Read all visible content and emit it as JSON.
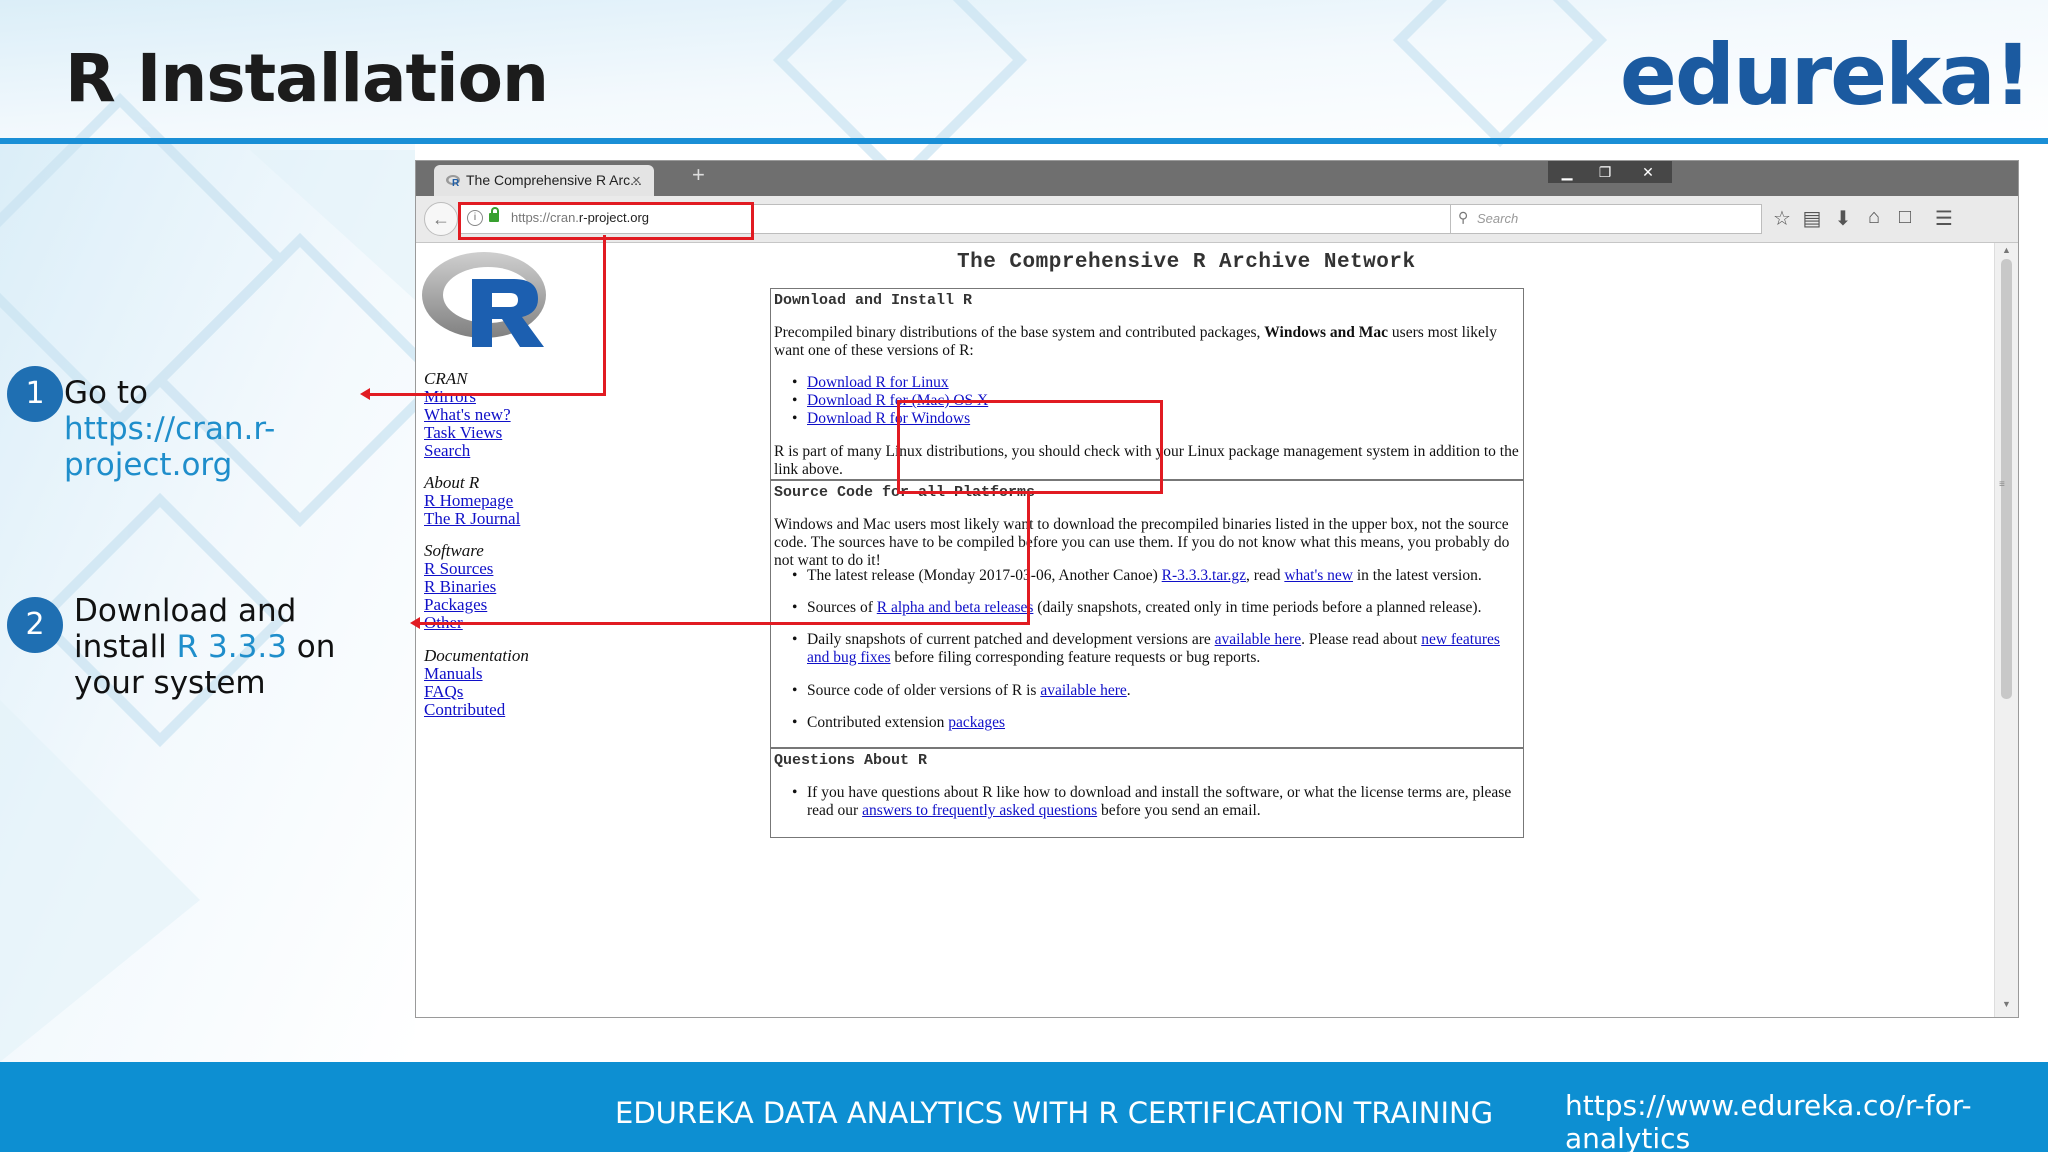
{
  "slide": {
    "title": "R Installation",
    "brand": "edureka!",
    "footer_course": "EDUREKA DATA ANALYTICS WITH R CERTIFICATION TRAINING",
    "footer_url": "https://www.edureka.co/r-for-analytics",
    "accent_color": "#1a8fd6",
    "brand_color": "#1b5aa0"
  },
  "steps": [
    {
      "number": "1",
      "text": "Go to ",
      "highlight": "https://cran.r-project.org"
    },
    {
      "number": "2",
      "text_before": "Download  and install ",
      "highlight": "R 3.3.3",
      "text_after": " on your system"
    }
  ],
  "browser": {
    "tab_label": "The Comprehensive R Arc...",
    "tab_close": "×",
    "new_tab": "+",
    "url_prefix": "https://cran.",
    "url_domain": "r-project.org",
    "search_placeholder": "Search",
    "window_controls": {
      "minimize": "▁",
      "restore": "❐",
      "close": "✕"
    },
    "toolbar_icons": [
      "star-icon",
      "reading-list-icon",
      "download-icon",
      "home-icon",
      "pocket-icon",
      "menu-icon"
    ]
  },
  "page": {
    "title": "The Comprehensive R Archive Network",
    "sidebar": [
      {
        "heading": "CRAN",
        "links": [
          "Mirrors",
          "What's new?",
          "Task Views",
          "Search"
        ]
      },
      {
        "heading": "About R",
        "links": [
          "R Homepage",
          "The R Journal"
        ]
      },
      {
        "heading": "Software",
        "links": [
          "R Sources",
          "R Binaries",
          "Packages",
          "Other"
        ]
      },
      {
        "heading": "Documentation",
        "links": [
          "Manuals",
          "FAQs",
          "Contributed"
        ]
      }
    ],
    "download_box": {
      "heading": "Download and Install R",
      "intro_1": "Precompiled binary distributions of the base system and contributed packages, ",
      "intro_bold": "Windows and Mac",
      "intro_2": " users most likely want one of these versions of R:",
      "links": [
        "Download R for Linux",
        "Download R for (Mac) OS X",
        "Download R for Windows"
      ],
      "note": "R is part of many Linux distributions, you should check with your Linux package management system in addition to the link above."
    },
    "source_box": {
      "heading": "Source Code for all Platforms",
      "intro": "Windows and Mac users most likely want to download the precompiled binaries listed in the upper box, not the source code. The sources have to be compiled before you can use them. If you do not know what this means, you probably do not want to do it!",
      "item1_a": "The latest release (Monday 2017-03-06, Another Canoe) ",
      "item1_link1": "R-3.3.3.tar.gz",
      "item1_b": ", read ",
      "item1_link2": "what's new",
      "item1_c": " in the latest version.",
      "item2_a": "Sources of ",
      "item2_link": "R alpha and beta releases",
      "item2_b": " (daily snapshots, created only in time periods before a planned release).",
      "item3_a": "Daily snapshots of current patched and development versions are ",
      "item3_link1": "available here",
      "item3_b": ". Please read about ",
      "item3_link2": "new features and bug fixes",
      "item3_c": " before filing corresponding feature requests or bug reports.",
      "item4_a": "Source code of older versions of R is ",
      "item4_link": "available here",
      "item4_b": ".",
      "item5_a": "Contributed extension ",
      "item5_link": "packages"
    },
    "questions_box": {
      "heading": "Questions About R",
      "item_a": "If you have questions about R like how to download and install the software, or what the license terms are, please read our ",
      "item_link": "answers to frequently asked questions",
      "item_b": " before you send an email."
    }
  }
}
